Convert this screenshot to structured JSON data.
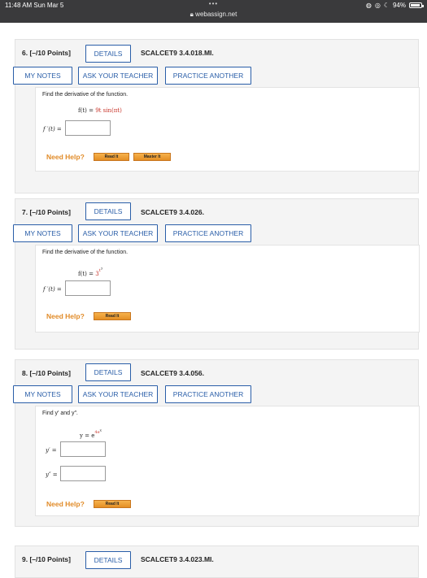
{
  "statusbar": {
    "time": "11:48 AM  Sun Mar 5",
    "dots": "•••",
    "url": "webassign.net",
    "battery": "94%",
    "battery_level": 0.94
  },
  "questions": [
    {
      "header": "6.  [–/10 Points]",
      "details": "DETAILS",
      "code": "SCALCET9 3.4.018.MI.",
      "my_notes": "MY NOTES",
      "ask": "ASK YOUR TEACHER",
      "practice": "PRACTICE ANOTHER",
      "prompt": "Find the derivative of the function.",
      "func_lhs": "f(t) = ",
      "func_rhs": "9t sin(πt)",
      "answer_labels": [
        "f ′(t) ="
      ],
      "need_help": "Need Help?",
      "help_buttons": [
        "Read It",
        "Master It"
      ]
    },
    {
      "header": "7.  [–/10 Points]",
      "details": "DETAILS",
      "code": "SCALCET9 3.4.026.",
      "my_notes": "MY NOTES",
      "ask": "ASK YOUR TEACHER",
      "practice": "PRACTICE ANOTHER",
      "prompt": "Find the derivative of the function.",
      "func_lhs": "f(t) = ",
      "func_base": "3",
      "func_exp": "t",
      "func_exp2": "3",
      "answer_labels": [
        "f ′(t) ="
      ],
      "need_help": "Need Help?",
      "help_buttons": [
        "Read It"
      ]
    },
    {
      "header": "8.  [–/10 Points]",
      "details": "DETAILS",
      "code": "SCALCET9 3.4.056.",
      "my_notes": "MY NOTES",
      "ask": "ASK YOUR TEACHER",
      "practice": "PRACTICE ANOTHER",
      "prompt": "Find y′ and y″.",
      "func_lhs": "y = e",
      "func_exp": "4e",
      "func_exp2": "x",
      "answer_labels": [
        "y′ =",
        "y″ ="
      ],
      "need_help": "Need Help?",
      "help_buttons": [
        "Read It"
      ]
    },
    {
      "header": "9.  [–/10 Points]",
      "details": "DETAILS",
      "code": "SCALCET9 3.4.023.MI."
    }
  ]
}
